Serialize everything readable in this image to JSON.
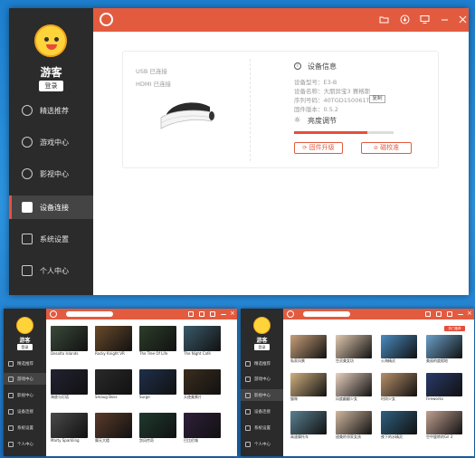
{
  "app": {
    "name": "游客",
    "login_label": "登录"
  },
  "sidebar": {
    "items": [
      {
        "label": "精选推荐",
        "icon": "bulb-icon"
      },
      {
        "label": "游戏中心",
        "icon": "gamepad-icon"
      },
      {
        "label": "影视中心",
        "icon": "film-icon"
      },
      {
        "label": "设备连接",
        "icon": "device-icon"
      },
      {
        "label": "系统设置",
        "icon": "settings-icon"
      },
      {
        "label": "个人中心",
        "icon": "grid-icon"
      }
    ],
    "active_index": 3
  },
  "titlebar": {
    "icons": [
      "folder-icon",
      "download-icon",
      "monitor-icon",
      "minimize-icon",
      "close-icon"
    ]
  },
  "device": {
    "usb_status": "USB  已连接",
    "hdmi_status": "HDMI  已连接",
    "info_title": "设备信息",
    "model_line": "设备型号：E3-B",
    "name_line": "设备名称：大朋异宝3 赛格斯",
    "serial_line": "序列号码：40TGD150061T",
    "copy_label": "复制",
    "firmware_line": "固件版本：0.5.2",
    "brightness_title": "亮度调节",
    "brightness_value": 0.74,
    "firmware_upgrade_label": "固件升级",
    "calibrate_label": "磁校准"
  },
  "colors": {
    "accent": "#e35b3f",
    "sidebar": "#2b2b2b",
    "desktop": "#2d94e0"
  },
  "mini_game": {
    "tiles": [
      "Desolto Islands",
      "Rocky Knight VR",
      "The Tree Of Life",
      "The Night Café",
      "海底与灯塔",
      "Smaug Boss",
      "Surge",
      "天使美景片",
      "Marty Sparkling",
      "摩天大楼",
      "剑风传奇",
      "巴比伦城"
    ]
  },
  "mini_video": {
    "header": "热门推荐",
    "tiles": [
      "私家风景",
      "空灵美女坊",
      "火海精灵",
      "美丽的度假地",
      "猫咪",
      "风度翩翩少女",
      "时尚少女",
      "Fireworks",
      "高速摩托车",
      "甜美的邻家女孩",
      "夜下的水精灵",
      "空中旋转的Gil 3"
    ]
  }
}
